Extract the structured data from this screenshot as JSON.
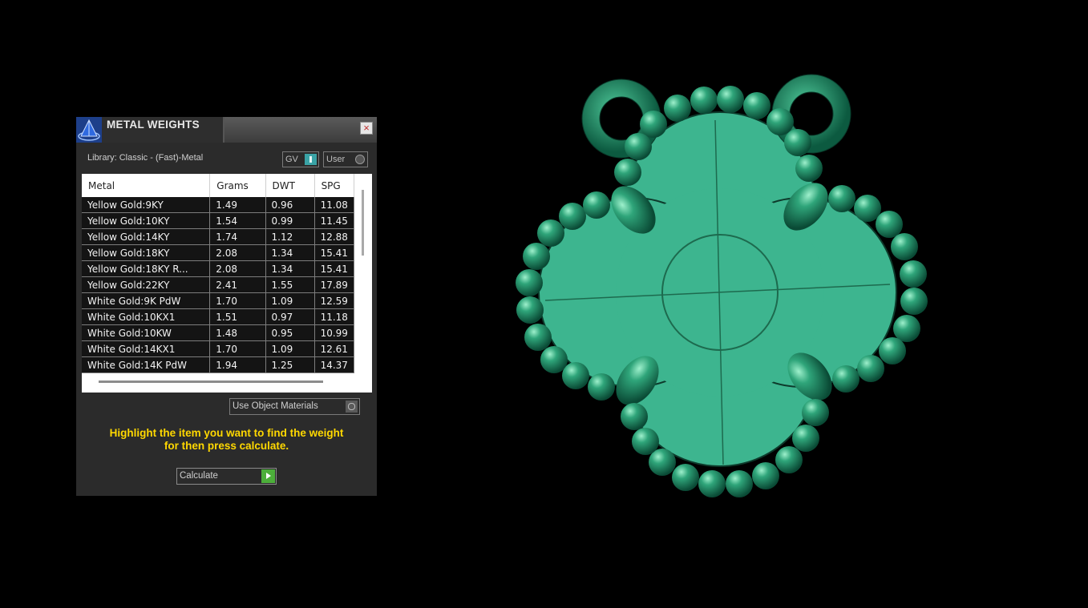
{
  "panel": {
    "title": "METAL WEIGHTS",
    "close_symbol": "×",
    "library_label": "Library: Classic - (Fast)-Metal",
    "gv_label": "GV",
    "user_label": "User",
    "table": {
      "headers": [
        "Metal",
        "Grams",
        "DWT",
        "SPG"
      ],
      "rows": [
        [
          "Yellow Gold:9KY",
          "1.49",
          "0.96",
          "11.08"
        ],
        [
          "Yellow Gold:10KY",
          "1.54",
          "0.99",
          "11.45"
        ],
        [
          "Yellow Gold:14KY",
          "1.74",
          "1.12",
          "12.88"
        ],
        [
          "Yellow Gold:18KY",
          "2.08",
          "1.34",
          "15.41"
        ],
        [
          "Yellow Gold:18KY R...",
          "2.08",
          "1.34",
          "15.41"
        ],
        [
          "Yellow Gold:22KY",
          "2.41",
          "1.55",
          "17.89"
        ],
        [
          "White Gold:9K PdW",
          "1.70",
          "1.09",
          "12.59"
        ],
        [
          "White Gold:10KX1",
          "1.51",
          "0.97",
          "11.18"
        ],
        [
          "White Gold:10KW",
          "1.48",
          "0.95",
          "10.99"
        ],
        [
          "White Gold:14KX1",
          "1.70",
          "1.09",
          "12.61"
        ],
        [
          "White Gold:14K PdW",
          "1.94",
          "1.25",
          "14.37"
        ]
      ]
    },
    "material_select": "Use Object Materials",
    "instructions_line1": "Highlight the item you want to find the weight",
    "instructions_line2": "for then press calculate.",
    "calculate_label": "Calculate"
  },
  "colors": {
    "model_green": "#3db58f",
    "bead_green": "#1f8f67",
    "instruction_yellow": "#ffd800",
    "toggle_teal": "#3aa3a6",
    "play_green": "#4caf3a"
  },
  "icons": {
    "app_logo": "pyramid-logo-icon",
    "close": "close-icon",
    "calculate": "play-icon"
  }
}
